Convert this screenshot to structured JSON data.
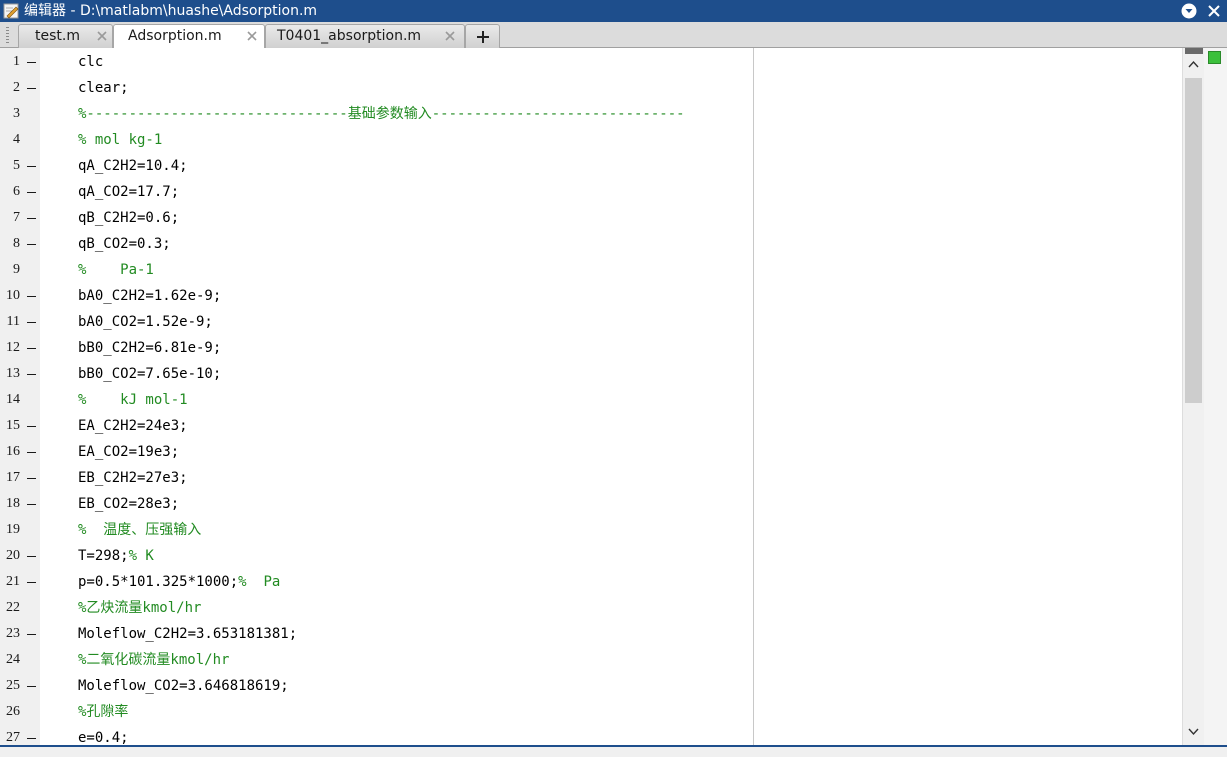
{
  "window": {
    "title": "编辑器 - D:\\matlabm\\huashe\\Adsorption.m"
  },
  "tabs": [
    {
      "label": "test.m",
      "active": false
    },
    {
      "label": "Adsorption.m",
      "active": true
    },
    {
      "label": "T0401_absorption.m",
      "active": false
    }
  ],
  "add_tab_label": "+",
  "colors": {
    "titlebar": "#1e4e8c",
    "comment": "#228b22",
    "code": "#000000",
    "gutter": "#f0f0f0"
  },
  "icons": {
    "app": "editor-pencil-icon",
    "menu": "chevron-down-circle-icon",
    "close": "close-icon",
    "tab_close": "close-icon",
    "add": "plus-icon"
  },
  "lines": [
    {
      "num": "1",
      "bp": true,
      "segments": [
        {
          "t": "clc",
          "c": "code"
        }
      ]
    },
    {
      "num": "2",
      "bp": true,
      "segments": [
        {
          "t": "clear;",
          "c": "code"
        }
      ]
    },
    {
      "num": "3",
      "bp": false,
      "segments": [
        {
          "t": "%-------------------------------基础参数输入------------------------------",
          "c": "cmt"
        }
      ]
    },
    {
      "num": "4",
      "bp": false,
      "segments": [
        {
          "t": "% mol kg-1",
          "c": "cmt"
        }
      ]
    },
    {
      "num": "5",
      "bp": true,
      "segments": [
        {
          "t": "qA_C2H2=10.4;",
          "c": "code"
        }
      ]
    },
    {
      "num": "6",
      "bp": true,
      "segments": [
        {
          "t": "qA_CO2=17.7;",
          "c": "code"
        }
      ]
    },
    {
      "num": "7",
      "bp": true,
      "segments": [
        {
          "t": "qB_C2H2=0.6;",
          "c": "code"
        }
      ]
    },
    {
      "num": "8",
      "bp": true,
      "segments": [
        {
          "t": "qB_CO2=0.3;",
          "c": "code"
        }
      ]
    },
    {
      "num": "9",
      "bp": false,
      "segments": [
        {
          "t": "%    Pa-1",
          "c": "cmt"
        }
      ]
    },
    {
      "num": "10",
      "bp": true,
      "segments": [
        {
          "t": "bA0_C2H2=1.62e-9;",
          "c": "code"
        }
      ]
    },
    {
      "num": "11",
      "bp": true,
      "segments": [
        {
          "t": "bA0_CO2=1.52e-9;",
          "c": "code"
        }
      ]
    },
    {
      "num": "12",
      "bp": true,
      "segments": [
        {
          "t": "bB0_C2H2=6.81e-9;",
          "c": "code"
        }
      ]
    },
    {
      "num": "13",
      "bp": true,
      "segments": [
        {
          "t": "bB0_CO2=7.65e-10;",
          "c": "code"
        }
      ]
    },
    {
      "num": "14",
      "bp": false,
      "segments": [
        {
          "t": "%    kJ mol-1",
          "c": "cmt"
        }
      ]
    },
    {
      "num": "15",
      "bp": true,
      "segments": [
        {
          "t": "EA_C2H2=24e3;",
          "c": "code"
        }
      ]
    },
    {
      "num": "16",
      "bp": true,
      "segments": [
        {
          "t": "EA_CO2=19e3;",
          "c": "code"
        }
      ]
    },
    {
      "num": "17",
      "bp": true,
      "segments": [
        {
          "t": "EB_C2H2=27e3;",
          "c": "code"
        }
      ]
    },
    {
      "num": "18",
      "bp": true,
      "segments": [
        {
          "t": "EB_CO2=28e3;",
          "c": "code"
        }
      ]
    },
    {
      "num": "19",
      "bp": false,
      "segments": [
        {
          "t": "%  温度、压强输入",
          "c": "cmt"
        }
      ]
    },
    {
      "num": "20",
      "bp": true,
      "segments": [
        {
          "t": "T=298;",
          "c": "code"
        },
        {
          "t": "% K",
          "c": "cmt"
        }
      ]
    },
    {
      "num": "21",
      "bp": true,
      "segments": [
        {
          "t": "p=0.5*101.325*1000;",
          "c": "code"
        },
        {
          "t": "%  Pa",
          "c": "cmt"
        }
      ]
    },
    {
      "num": "22",
      "bp": false,
      "segments": [
        {
          "t": "%乙炔流量kmol/hr",
          "c": "cmt"
        }
      ]
    },
    {
      "num": "23",
      "bp": true,
      "segments": [
        {
          "t": "Moleflow_C2H2=3.653181381;",
          "c": "code"
        }
      ]
    },
    {
      "num": "24",
      "bp": false,
      "segments": [
        {
          "t": "%二氧化碳流量kmol/hr",
          "c": "cmt"
        }
      ]
    },
    {
      "num": "25",
      "bp": true,
      "segments": [
        {
          "t": "Moleflow_CO2=3.646818619;",
          "c": "code"
        }
      ]
    },
    {
      "num": "26",
      "bp": false,
      "segments": [
        {
          "t": "%孔隙率",
          "c": "cmt"
        }
      ]
    },
    {
      "num": "27",
      "bp": true,
      "segments": [
        {
          "t": "e=0.4;",
          "c": "code"
        }
      ]
    }
  ]
}
